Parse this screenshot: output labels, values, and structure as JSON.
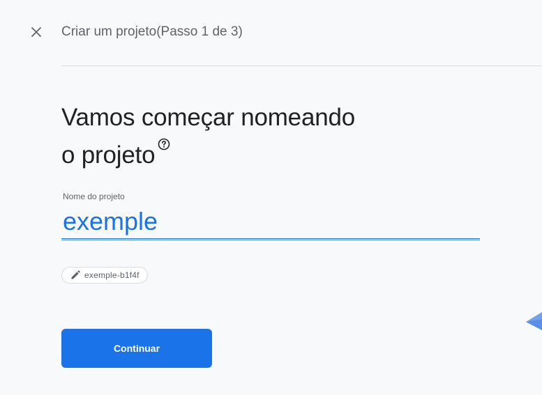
{
  "header": {
    "title": "Criar um projeto(Passo 1 de 3)",
    "close_icon": "close-icon"
  },
  "main": {
    "headline_line1": "Vamos começar nomeando",
    "headline_line2": "o projeto",
    "help_icon": "help-circle-icon",
    "project_name_label": "Nome do projeto",
    "project_name_value": "exemple",
    "project_id_chip": {
      "icon": "pencil-icon",
      "label": "exemple-b1f4f"
    },
    "continue_label": "Continuar"
  },
  "colors": {
    "accent": "#1a73e8",
    "text_primary": "#202124",
    "text_secondary": "#5f6368",
    "background": "#f8f9fa"
  }
}
